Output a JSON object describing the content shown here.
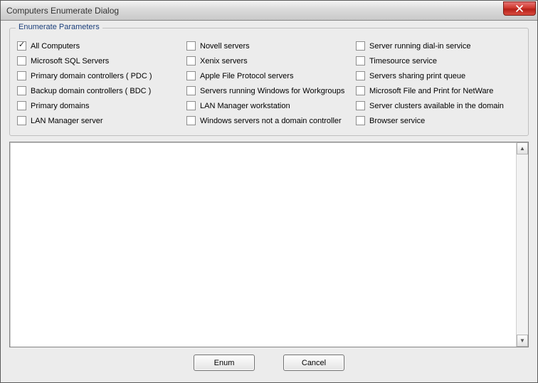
{
  "window": {
    "title": "Computers Enumerate Dialog"
  },
  "groupbox": {
    "legend": "Enumerate Parameters"
  },
  "checkboxes": {
    "col1": [
      {
        "label": "All Computers",
        "checked": true
      },
      {
        "label": "Microsoft SQL Servers",
        "checked": false
      },
      {
        "label": "Primary domain controllers ( PDC )",
        "checked": false
      },
      {
        "label": "Backup domain controllers ( BDC )",
        "checked": false
      },
      {
        "label": "Primary domains",
        "checked": false
      },
      {
        "label": "LAN Manager server",
        "checked": false
      }
    ],
    "col2": [
      {
        "label": "Novell servers",
        "checked": false
      },
      {
        "label": "Xenix servers",
        "checked": false
      },
      {
        "label": "Apple File Protocol servers",
        "checked": false
      },
      {
        "label": "Servers running Windows for Workgroups",
        "checked": false
      },
      {
        "label": "LAN Manager workstation",
        "checked": false
      },
      {
        "label": "Windows servers not a domain controller",
        "checked": false
      }
    ],
    "col3": [
      {
        "label": "Server running dial-in service",
        "checked": false
      },
      {
        "label": "Timesource service",
        "checked": false
      },
      {
        "label": "Servers sharing print queue",
        "checked": false
      },
      {
        "label": "Microsoft File and Print for NetWare",
        "checked": false
      },
      {
        "label": "Server clusters available in the domain",
        "checked": false
      },
      {
        "label": "Browser service",
        "checked": false
      }
    ]
  },
  "buttons": {
    "enum": "Enum",
    "cancel": "Cancel"
  }
}
